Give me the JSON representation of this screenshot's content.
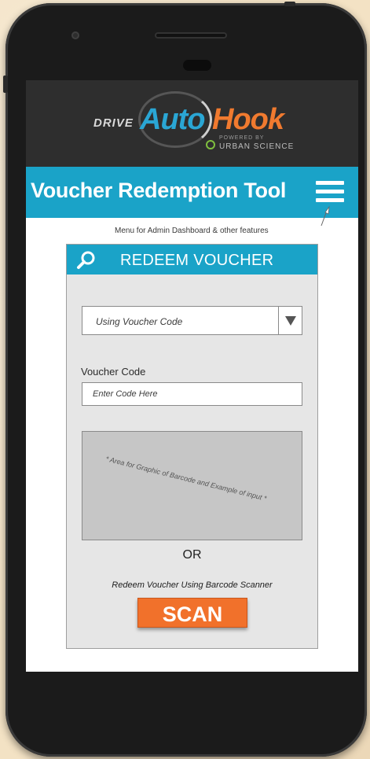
{
  "device": {
    "icons": {
      "camera": "camera-icon",
      "speaker": "speaker-icon",
      "sensor": "sensor-icon"
    }
  },
  "header": {
    "logo_drive": "DRIVE",
    "logo_auto": "Auto",
    "logo_hook": "Hook",
    "logo_powered": "POWERED BY",
    "logo_urban": "URBAN SCIENCE",
    "brand_colors": {
      "auto": "#2aa6d4",
      "hook": "#f07a2f",
      "background": "#2e2e2e"
    }
  },
  "title_bar": {
    "title": "Voucher Redemption Tool",
    "menu_icon": "hamburger-menu-icon",
    "color": "#1aa3c8"
  },
  "annotation": {
    "menu_note": "Menu for Admin Dashboard & other features"
  },
  "panel": {
    "heading": "REDEEM VOUCHER",
    "heading_icon": "search-icon",
    "method_select": {
      "value": "Using Voucher Code",
      "icon": "dropdown-arrow-icon"
    },
    "voucher_code_label": "Voucher Code",
    "voucher_code_placeholder": "Enter Code Here",
    "graphic_placeholder": "* Area for Graphic of Barcode and Example of input *",
    "or_label": "OR",
    "scanner_text": "Redeem Voucher Using Barcode Scanner",
    "scan_button": "SCAN",
    "scan_color": "#f1712b"
  }
}
